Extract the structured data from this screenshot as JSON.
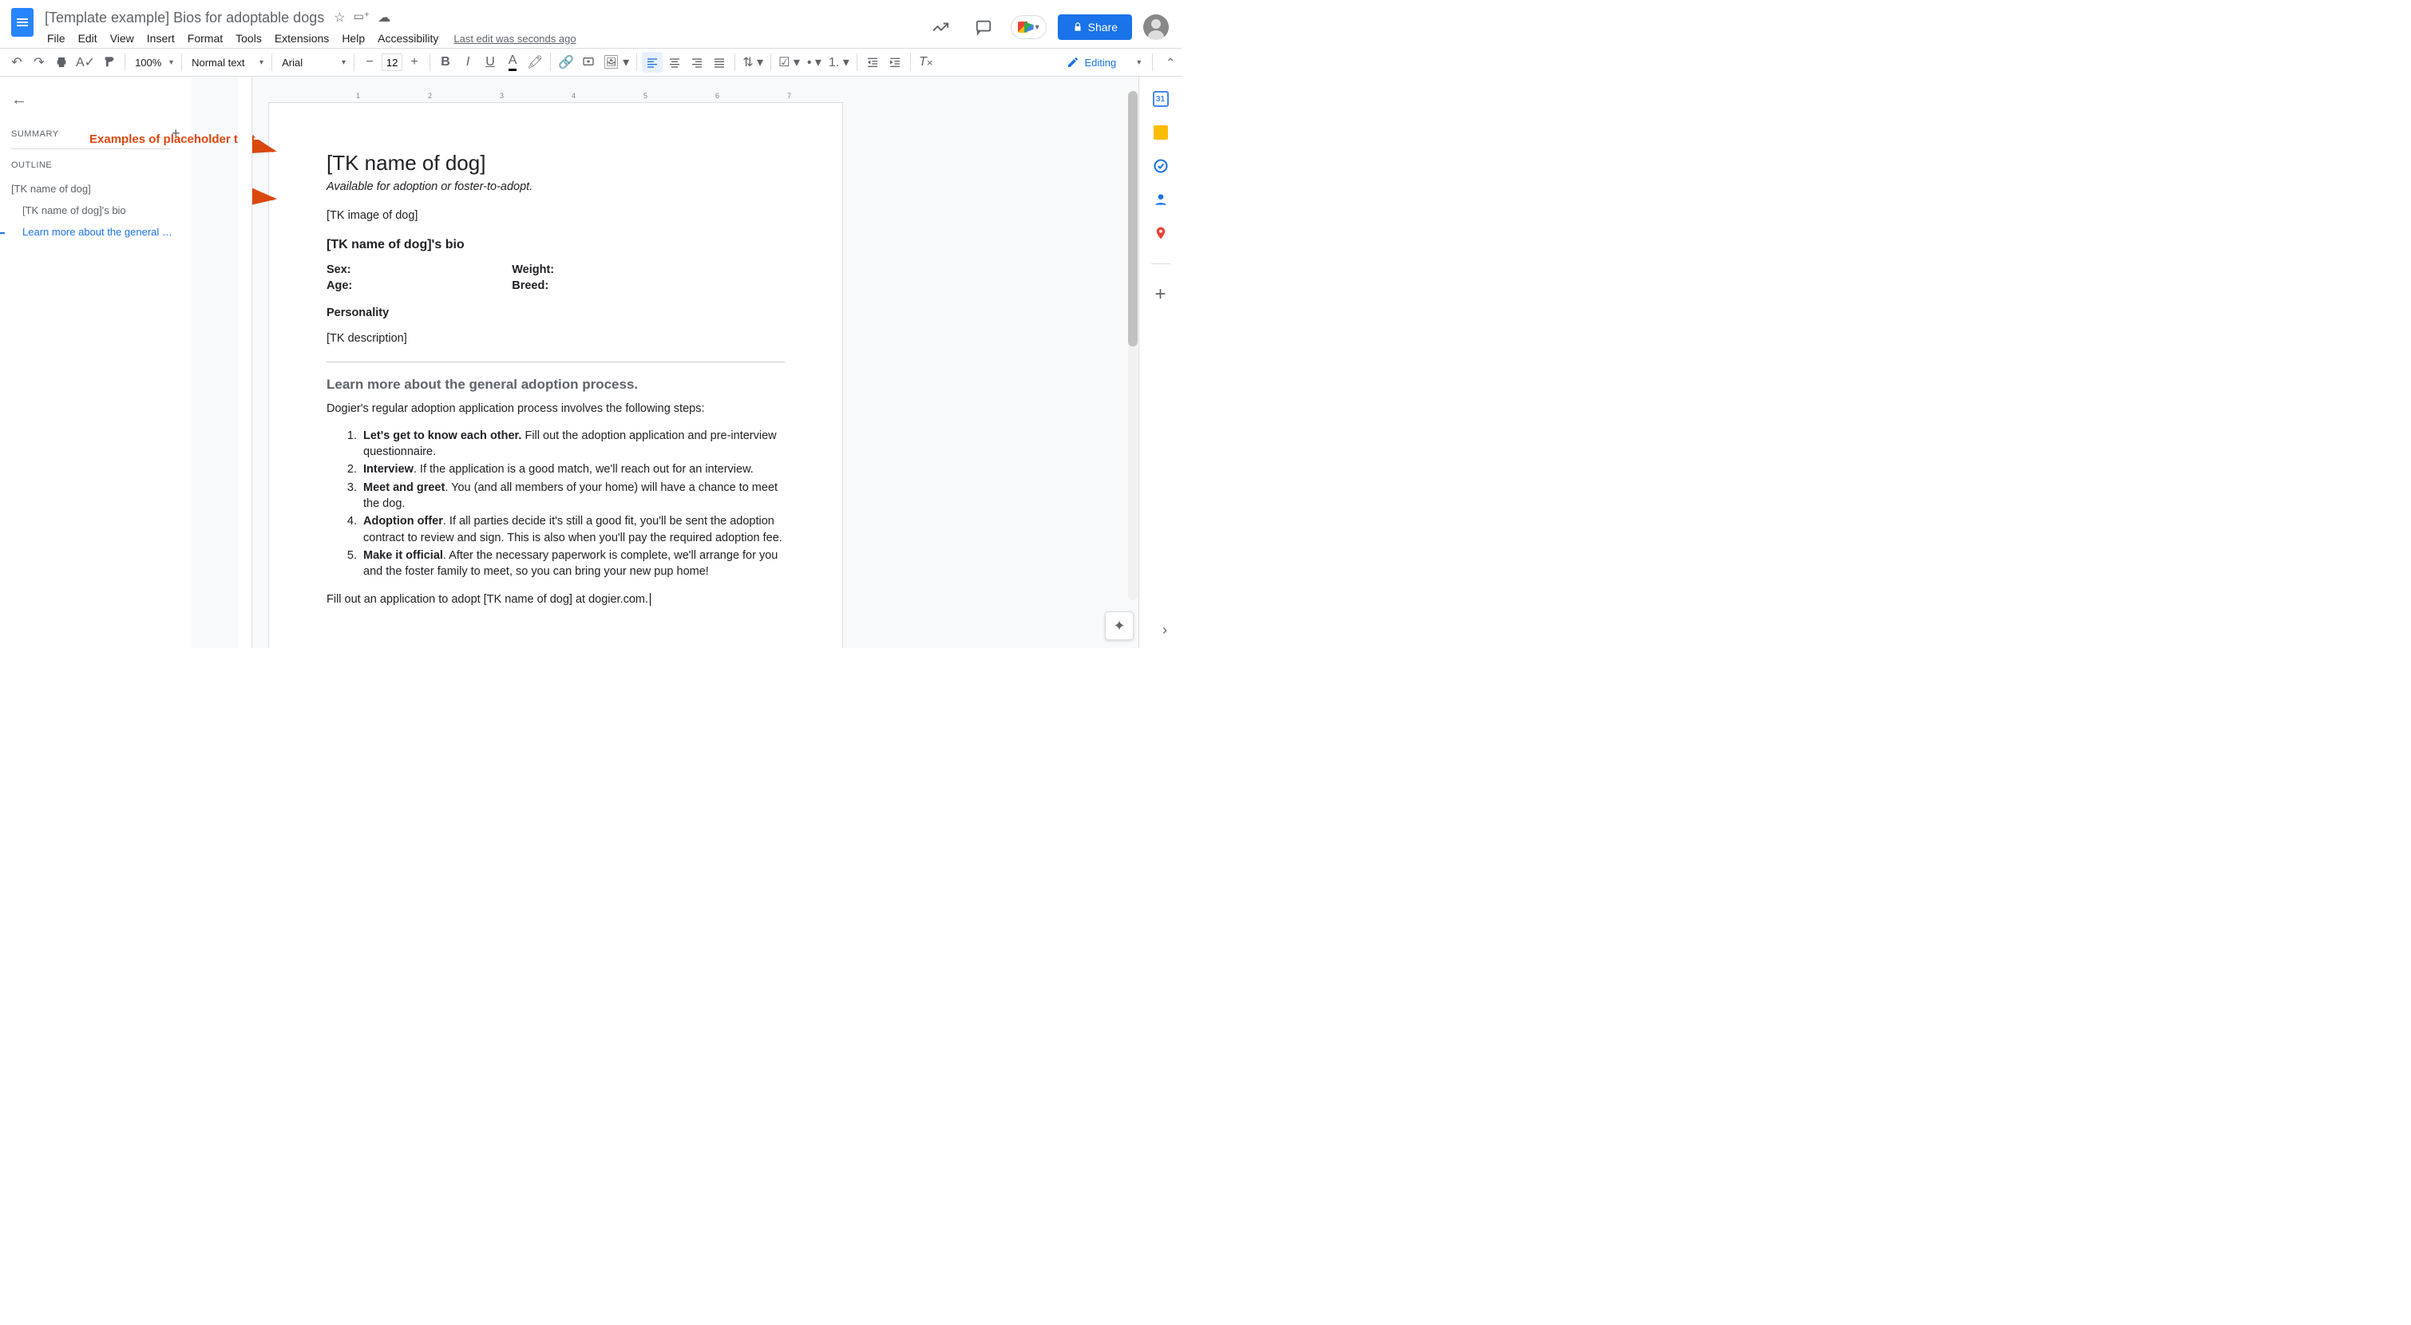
{
  "header": {
    "doc_title": "[Template example] Bios for adoptable dogs",
    "star_tooltip": "Star",
    "move_tooltip": "Move",
    "cloud_tooltip": "See document status",
    "menu": [
      "File",
      "Edit",
      "View",
      "Insert",
      "Format",
      "Tools",
      "Extensions",
      "Help",
      "Accessibility"
    ],
    "last_edit": "Last edit was seconds ago",
    "share_label": "Share"
  },
  "toolbar": {
    "zoom": "100%",
    "style": "Normal text",
    "font": "Arial",
    "font_size": "12",
    "editing_label": "Editing"
  },
  "outline": {
    "summary_label": "SUMMARY",
    "outline_label": "OUTLINE",
    "items": [
      {
        "label": "[TK name of dog]",
        "level": 0
      },
      {
        "label": "[TK name of dog]'s bio",
        "level": 1
      },
      {
        "label": "Learn more about the general …",
        "level": 1,
        "active": true
      }
    ]
  },
  "ruler": {
    "marks": [
      "1",
      "2",
      "3",
      "4",
      "5",
      "6",
      "7"
    ]
  },
  "annotation": {
    "label": "Examples of placeholder text"
  },
  "doc": {
    "h1": "[TK name of dog]",
    "subtitle": "Available for adoption or foster-to-adopt.",
    "image_placeholder": "[TK image of dog]",
    "h2_bio": "[TK name of dog]'s bio",
    "fields": {
      "sex": "Sex:",
      "age": "Age:",
      "weight": "Weight:",
      "breed": "Breed:"
    },
    "personality_label": "Personality",
    "description_placeholder": "[TK description]",
    "h3_process": "Learn more about the general adoption process.",
    "process_intro": "Dogier's regular adoption application process involves the following steps:",
    "steps": [
      {
        "b": "Let's get to know each other.",
        "rest": " Fill out the adoption application and pre-interview questionnaire."
      },
      {
        "b": "Interview",
        "rest": ". If the application is a good match, we'll reach out for an interview."
      },
      {
        "b": "Meet and greet",
        "rest": ". You (and all members of your home) will have a chance to meet the dog."
      },
      {
        "b": "Adoption offer",
        "rest": ". If all parties decide it's still a good fit, you'll be sent the adoption contract to review and sign. This is also when you'll pay the required adoption fee."
      },
      {
        "b": "Make it official",
        "rest": ". After the necessary paperwork is complete, we'll arrange for you and the foster family to meet, so you can bring your new pup home!"
      }
    ],
    "cta": "Fill out an application to adopt [TK name of dog] at dogier.com."
  },
  "sidepanel": {
    "calendar_day": "31"
  }
}
